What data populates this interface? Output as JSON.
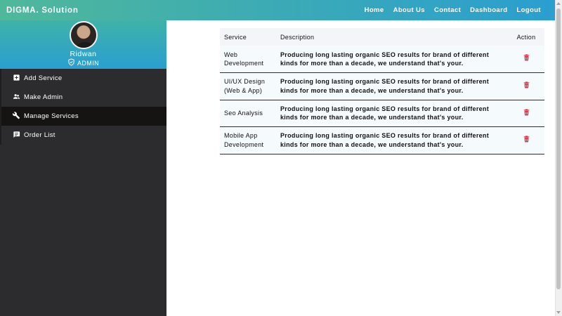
{
  "brand": "DIGMA. Solution",
  "nav": [
    {
      "label": "Home"
    },
    {
      "label": "About Us"
    },
    {
      "label": "Contact"
    },
    {
      "label": "Dashboard"
    },
    {
      "label": "Logout"
    }
  ],
  "profile": {
    "name": "Ridwan",
    "role": "ADMIN"
  },
  "menu": [
    {
      "label": "Add Service",
      "icon": "add-box-icon"
    },
    {
      "label": "Make Admin",
      "icon": "people-icon"
    },
    {
      "label": "Manage Services",
      "icon": "wrench-icon",
      "active": true
    },
    {
      "label": "Order List",
      "icon": "comment-list-icon"
    }
  ],
  "table": {
    "headers": {
      "service": "Service",
      "description": "Description",
      "action": "Action"
    },
    "rows": [
      {
        "service": "Web Development",
        "description": "Producing long lasting organic SEO results for brand of different kinds for more than a decade, we understand that's your."
      },
      {
        "service": "UI/UX Design (Web & App)",
        "description": "Producing long lasting organic SEO results for brand of different kinds for more than a decade, we understand that's your."
      },
      {
        "service": "Seo Analysis",
        "description": "Producing long lasting organic SEO results for brand of different kinds for more than a decade, we understand that's your."
      },
      {
        "service": "Mobile App Development",
        "description": "Producing long lasting organic SEO results for brand of different kinds for more than a decade, we understand that's your."
      }
    ],
    "action_icon": "trash-icon"
  },
  "colors": {
    "header_gradient_start": "#4fb89a",
    "header_gradient_end": "#2a9fd0",
    "sidebar_bg": "#2c2b2e",
    "sidebar_active_bg": "#161313",
    "delete_icon": "#e0243b"
  }
}
